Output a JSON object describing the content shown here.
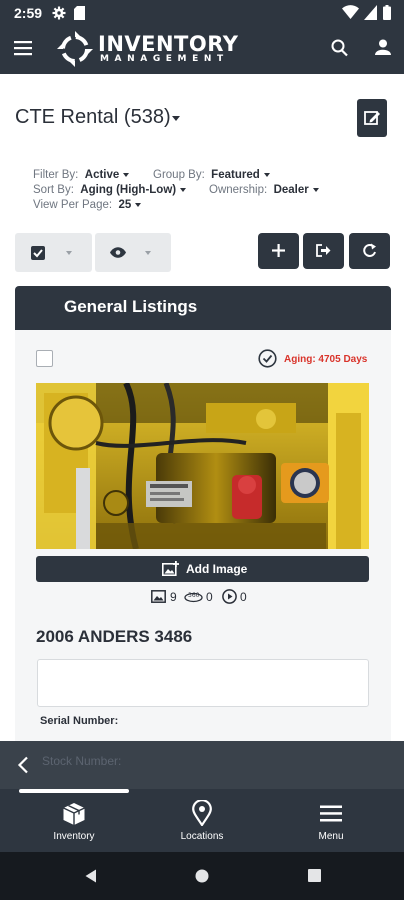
{
  "status_bar": {
    "time": "2:59"
  },
  "brand": {
    "name_top": "INVENTORY",
    "name_bottom": "MANAGEMENT"
  },
  "page": {
    "title": "CTE Rental (538)"
  },
  "filters": {
    "filter_by_label": "Filter By:",
    "filter_by_value": "Active",
    "group_by_label": "Group By:",
    "group_by_value": "Featured",
    "sort_by_label": "Sort By:",
    "sort_by_value": "Aging (High-Low)",
    "ownership_label": "Ownership:",
    "ownership_value": "Dealer",
    "view_per_page_label": "View Per Page:",
    "view_per_page_value": "25"
  },
  "section": {
    "title": "General Listings"
  },
  "listing": {
    "aging": "Aging: 4705 Days",
    "add_image_label": "Add Image",
    "image_count": "9",
    "spin_count": "0",
    "video_count": "0",
    "title": "2006 ANDERS 3486",
    "serial_label": "Serial Number:",
    "stock_label_ghost": "Stock Number:"
  },
  "tabs": [
    {
      "label": "Inventory",
      "icon": "box-icon"
    },
    {
      "label": "Locations",
      "icon": "location-pin-icon"
    },
    {
      "label": "Menu",
      "icon": "menu-icon"
    }
  ],
  "colors": {
    "primary": "#2e3640",
    "accent_red": "#d9342b",
    "control_bg": "#e8eaec",
    "card_bg": "#f5f6f7"
  }
}
